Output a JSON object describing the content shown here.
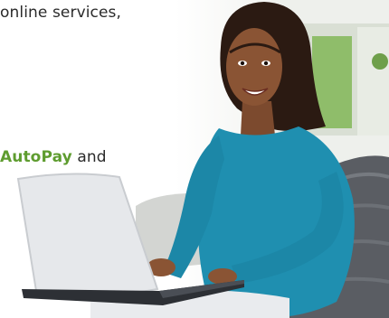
{
  "copy": {
    "line_1": "online services,",
    "line_2_accent": "AutoPay",
    "line_2_rest": " and"
  },
  "colors": {
    "accent": "#5e9c2f",
    "sweater": "#1f8fb0",
    "text": "#2a2a2a"
  }
}
